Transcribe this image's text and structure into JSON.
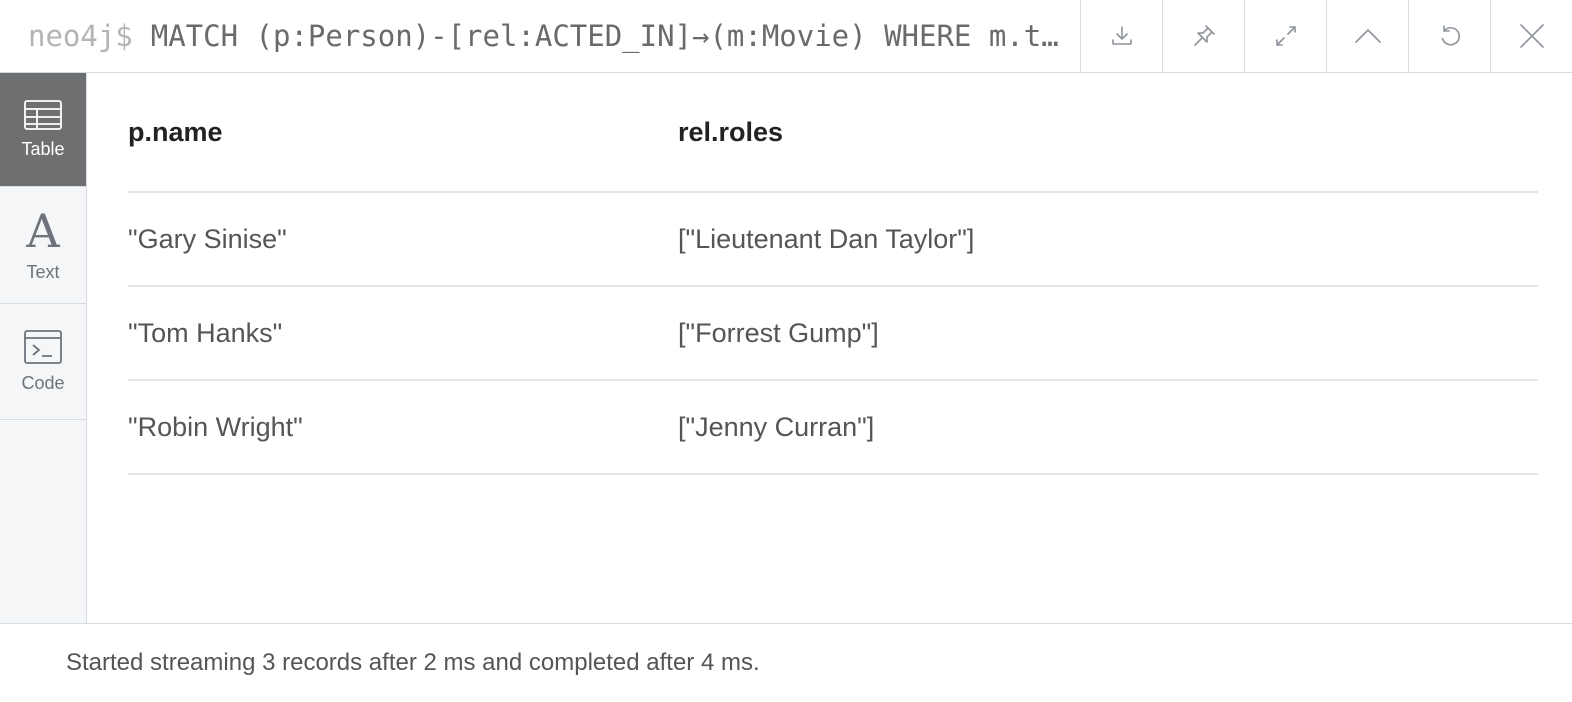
{
  "query_bar": {
    "prompt": "neo4j$",
    "query": "MATCH (p:Person)-[rel:ACTED_IN]→(m:Movie) WHERE m.title = \"Forrest Gump\" RETURN p.name, rel.roles"
  },
  "actions": [
    {
      "name": "download",
      "icon": "download-icon"
    },
    {
      "name": "pin",
      "icon": "pin-icon"
    },
    {
      "name": "fullscreen",
      "icon": "expand-icon"
    },
    {
      "name": "collapse",
      "icon": "chevron-up-icon"
    },
    {
      "name": "rerun",
      "icon": "refresh-icon"
    },
    {
      "name": "close",
      "icon": "close-icon"
    }
  ],
  "views": [
    {
      "label": "Table",
      "icon": "table-icon",
      "active": true
    },
    {
      "label": "Text",
      "icon": "text-icon",
      "active": false
    },
    {
      "label": "Code",
      "icon": "code-icon",
      "active": false
    }
  ],
  "table": {
    "columns": [
      "p.name",
      "rel.roles"
    ],
    "rows": [
      [
        "\"Gary Sinise\"",
        "[\"Lieutenant Dan Taylor\"]"
      ],
      [
        "\"Tom Hanks\"",
        "[\"Forrest Gump\"]"
      ],
      [
        "\"Robin Wright\"",
        "[\"Jenny Curran\"]"
      ]
    ]
  },
  "status": "Started streaming 3 records after 2 ms and completed after 4 ms."
}
